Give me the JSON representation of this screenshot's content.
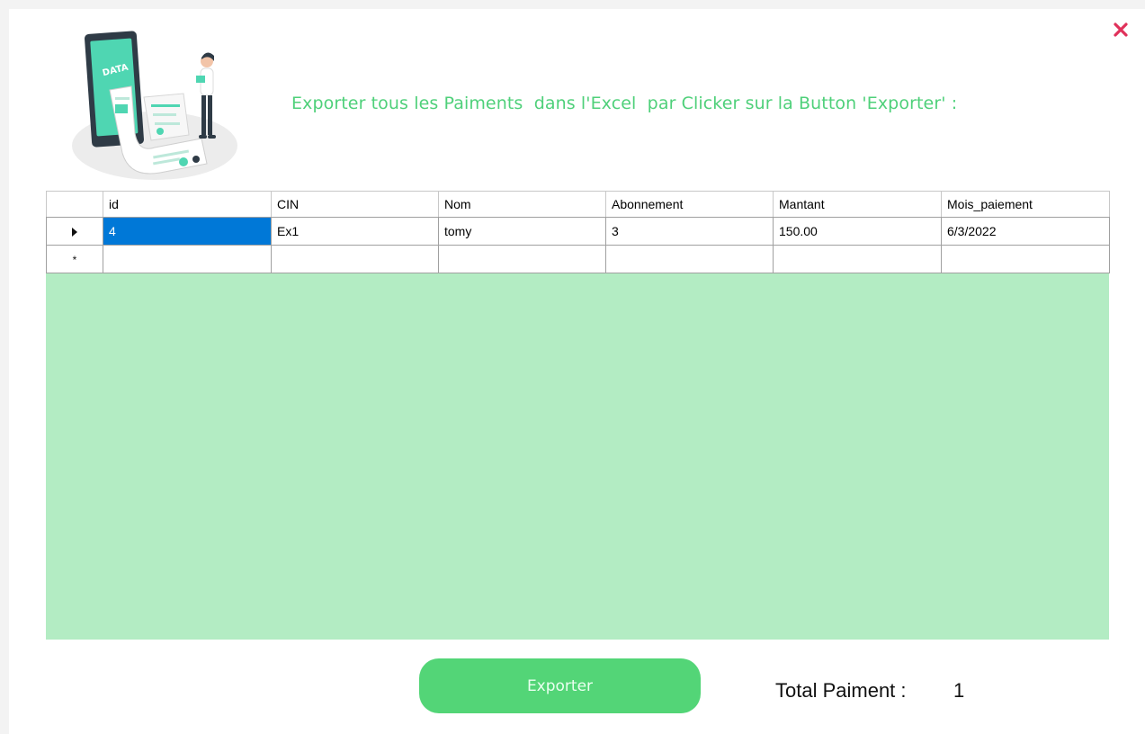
{
  "window": {
    "close_icon": "close-icon",
    "close_color": "#e0315a",
    "illustration": {
      "icon": "data-report-illustration-icon",
      "label": "DATA"
    },
    "headline": "Exporter tous les Paiments  dans l'Excel  par Clicker sur la Button 'Exporter' :",
    "headline_color": "#4fd07a"
  },
  "grid": {
    "background": "#b3ecc3",
    "columns": [
      "id",
      "CIN",
      "Nom",
      "Abonnement",
      "Mantant",
      "Mois_paiement"
    ],
    "rows": [
      {
        "id": "4",
        "CIN": "Ex1",
        "Nom": "tomy",
        "Abonnement": "3",
        "Mantant": "150.00",
        "Mois_paiement": "6/3/2022"
      }
    ],
    "current_row_icon": "row-pointer-icon",
    "new_row_icon": "new-row-star-icon",
    "new_row_glyph": "*",
    "selection_color": "#0078d7"
  },
  "footer": {
    "export_label": "Exporter",
    "export_color": "#53d577",
    "total_label": "Total Paiment :",
    "total_value": "1"
  }
}
